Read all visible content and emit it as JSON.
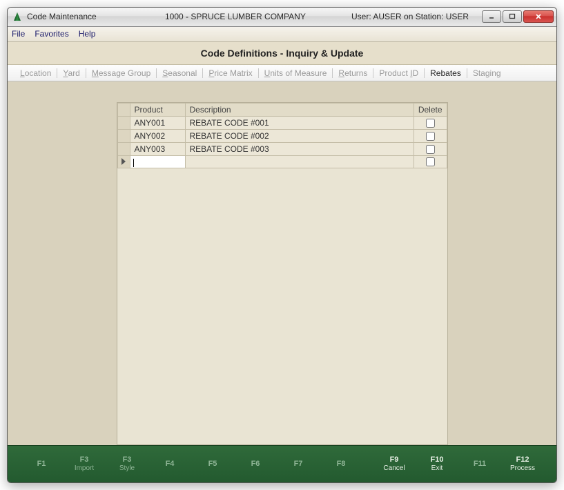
{
  "window": {
    "app_title": "Code Maintenance",
    "company": "1000 - SPRUCE LUMBER COMPANY",
    "user_station": "User: AUSER on Station: USER"
  },
  "menu": {
    "file": "File",
    "favorites": "Favorites",
    "help": "Help"
  },
  "heading": "Code Definitions - Inquiry & Update",
  "tabs": {
    "location": "Location",
    "yard": "Yard",
    "message_group": "Message Group",
    "seasonal": "Seasonal",
    "price_matrix": "Price Matrix",
    "units": "Units of Measure",
    "returns": "Returns",
    "product_id": "Product ID",
    "rebates": "Rebates",
    "staging": "Staging"
  },
  "grid": {
    "headers": {
      "product": "Product",
      "description": "Description",
      "delete": "Delete"
    },
    "rows": [
      {
        "product": "ANY001",
        "description": "REBATE CODE #001"
      },
      {
        "product": "ANY002",
        "description": "REBATE CODE #002"
      },
      {
        "product": "ANY003",
        "description": "REBATE CODE #003"
      }
    ],
    "new_row_value": ""
  },
  "fkeys": {
    "f1": {
      "num": "F1",
      "label": ""
    },
    "f3": {
      "num": "F3",
      "label": "Import"
    },
    "f3b": {
      "num": "F3",
      "label": "Style"
    },
    "f4": {
      "num": "F4",
      "label": ""
    },
    "f5": {
      "num": "F5",
      "label": ""
    },
    "f6": {
      "num": "F6",
      "label": ""
    },
    "f7": {
      "num": "F7",
      "label": ""
    },
    "f8": {
      "num": "F8",
      "label": ""
    },
    "f9": {
      "num": "F9",
      "label": "Cancel"
    },
    "f10": {
      "num": "F10",
      "label": "Exit"
    },
    "f11": {
      "num": "F11",
      "label": ""
    },
    "f12": {
      "num": "F12",
      "label": "Process"
    }
  }
}
